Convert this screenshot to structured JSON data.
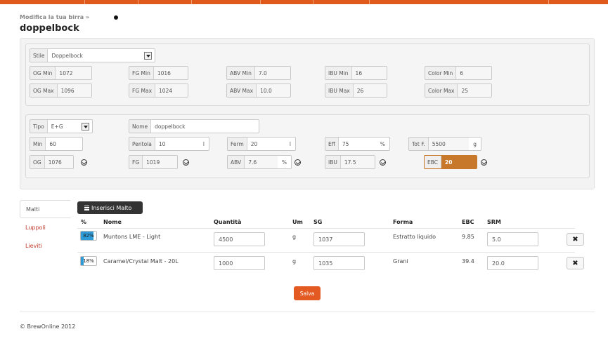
{
  "header": {
    "breadcrumb": "Modifica la tua birra »",
    "title": "doppelbock",
    "accent_color": "#e05a1c"
  },
  "style_section": {
    "stile_label": "Stile",
    "stile_value": "Doppelbock",
    "og_min_label": "OG Min",
    "og_min_value": "1072",
    "og_max_label": "OG Max",
    "og_max_value": "1096",
    "fg_min_label": "FG Min",
    "fg_min_value": "1016",
    "fg_max_label": "FG Max",
    "fg_max_value": "1024",
    "abv_min_label": "ABV Min",
    "abv_min_value": "7.0",
    "abv_max_label": "ABV Max",
    "abv_max_value": "10.0",
    "ibu_min_label": "IBU Min",
    "ibu_min_value": "16",
    "ibu_max_label": "IBU Max",
    "ibu_max_value": "26",
    "color_min_label": "Color Min",
    "color_min_value": "6",
    "color_max_label": "Color Max",
    "color_max_value": "25"
  },
  "recipe_section": {
    "tipo_label": "Tipo",
    "tipo_value": "E+G",
    "nome_label": "Nome",
    "nome_value": "doppelbock",
    "min_label": "Min",
    "min_value": "60",
    "pentola_label": "Pentola",
    "pentola_value": "10",
    "pentola_unit": "l",
    "ferm_label": "Ferm",
    "ferm_value": "20",
    "ferm_unit": "l",
    "eff_label": "Eff",
    "eff_value": "75",
    "eff_unit": "%",
    "totf_label": "Tot F.",
    "totf_value": "5500",
    "totf_unit": "g",
    "og_label": "OG",
    "og_value": "1076",
    "fg_label": "FG",
    "fg_value": "1019",
    "abv_label": "ABV",
    "abv_value": "7.6",
    "abv_unit": "%",
    "ibu_label": "IBU",
    "ibu_value": "17.5",
    "ebc_label": "EBC",
    "ebc_value": "20",
    "ebc_color": "#c8782a"
  },
  "tabs": [
    {
      "label": "Malti"
    },
    {
      "label": "Luppoli"
    },
    {
      "label": "Lieviti"
    }
  ],
  "malts": {
    "add_button": "Inserisci Malto",
    "columns": [
      "%",
      "Nome",
      "Quantità",
      "Um",
      "SG",
      "Forma",
      "EBC",
      "SRM"
    ],
    "rows": [
      {
        "percent": 82,
        "percent_label": "82%",
        "name": "Muntons LME - Light",
        "quantity": "4500",
        "um": "g",
        "sg": "1037",
        "forma": "Estratto liquido",
        "ebc": "9.85",
        "srm": "5.0"
      },
      {
        "percent": 18,
        "percent_label": "18%",
        "name": "Caramel/Crystal Malt - 20L",
        "quantity": "1000",
        "um": "g",
        "sg": "1035",
        "forma": "Grani",
        "ebc": "39.4",
        "srm": "20.0"
      }
    ],
    "remove_glyph": "✖"
  },
  "actions": {
    "save_label": "Salva"
  },
  "footer": {
    "copyright": "© BrewOnline 2012"
  }
}
